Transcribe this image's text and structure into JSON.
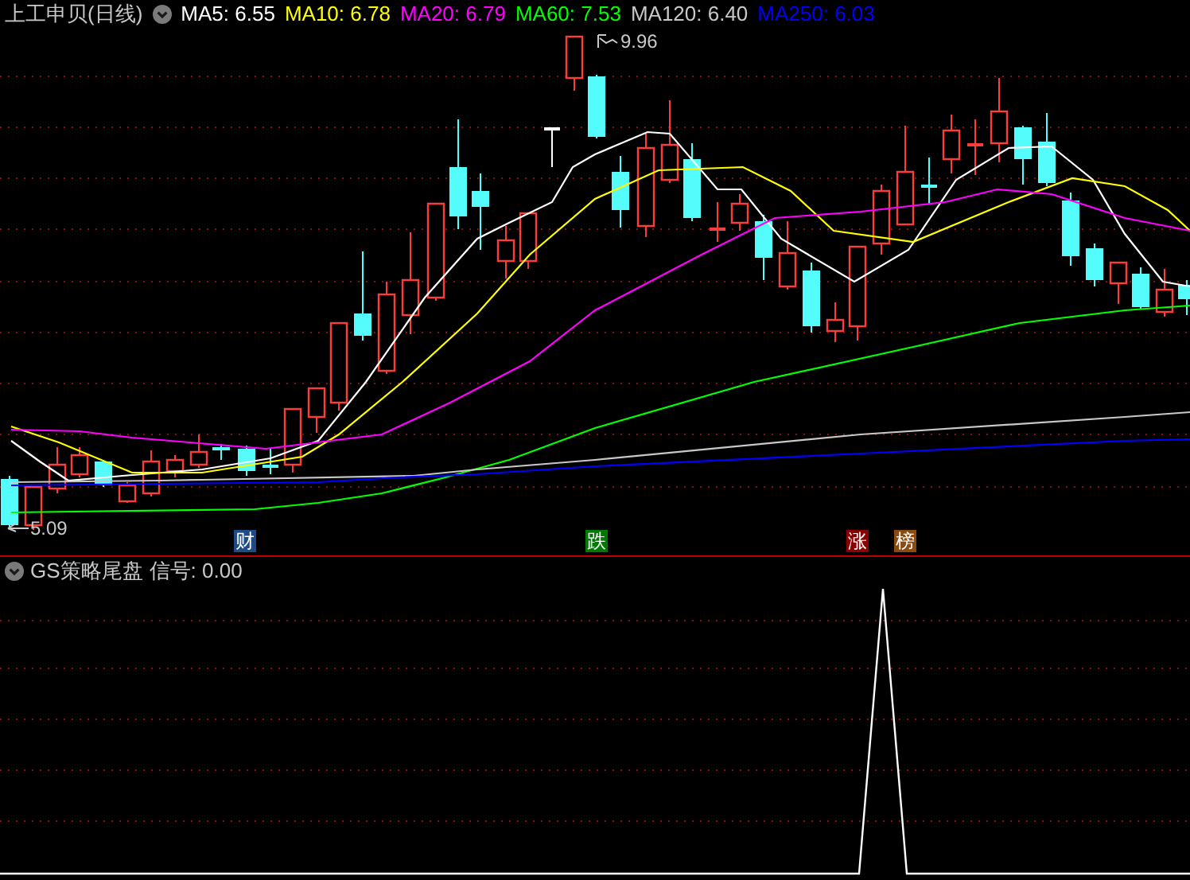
{
  "title": {
    "name": "上工申贝",
    "period": "(日线)"
  },
  "ma_legend": [
    {
      "label": "MA5: 6.55",
      "color": "#ffffff"
    },
    {
      "label": "MA10: 6.78",
      "color": "#ffff00"
    },
    {
      "label": "MA20: 6.79",
      "color": "#ff00ff"
    },
    {
      "label": "MA60: 7.53",
      "color": "#00ff00"
    },
    {
      "label": "MA120: 6.40",
      "color": "#c8c8c8"
    },
    {
      "label": "MA250: 6.03",
      "color": "#0000ff"
    }
  ],
  "price_chart": {
    "high_label": "9.96",
    "low_label": "5.09"
  },
  "markers": [
    {
      "text": "财",
      "color": "#1e4a86"
    },
    {
      "text": "跌",
      "color": "#007a00"
    },
    {
      "text": "涨",
      "color": "#8b0000"
    },
    {
      "text": "榜",
      "color": "#8b4a10"
    }
  ],
  "indicator": {
    "name": "GS策略尾盘",
    "reading": "信号: 0.00"
  }
}
